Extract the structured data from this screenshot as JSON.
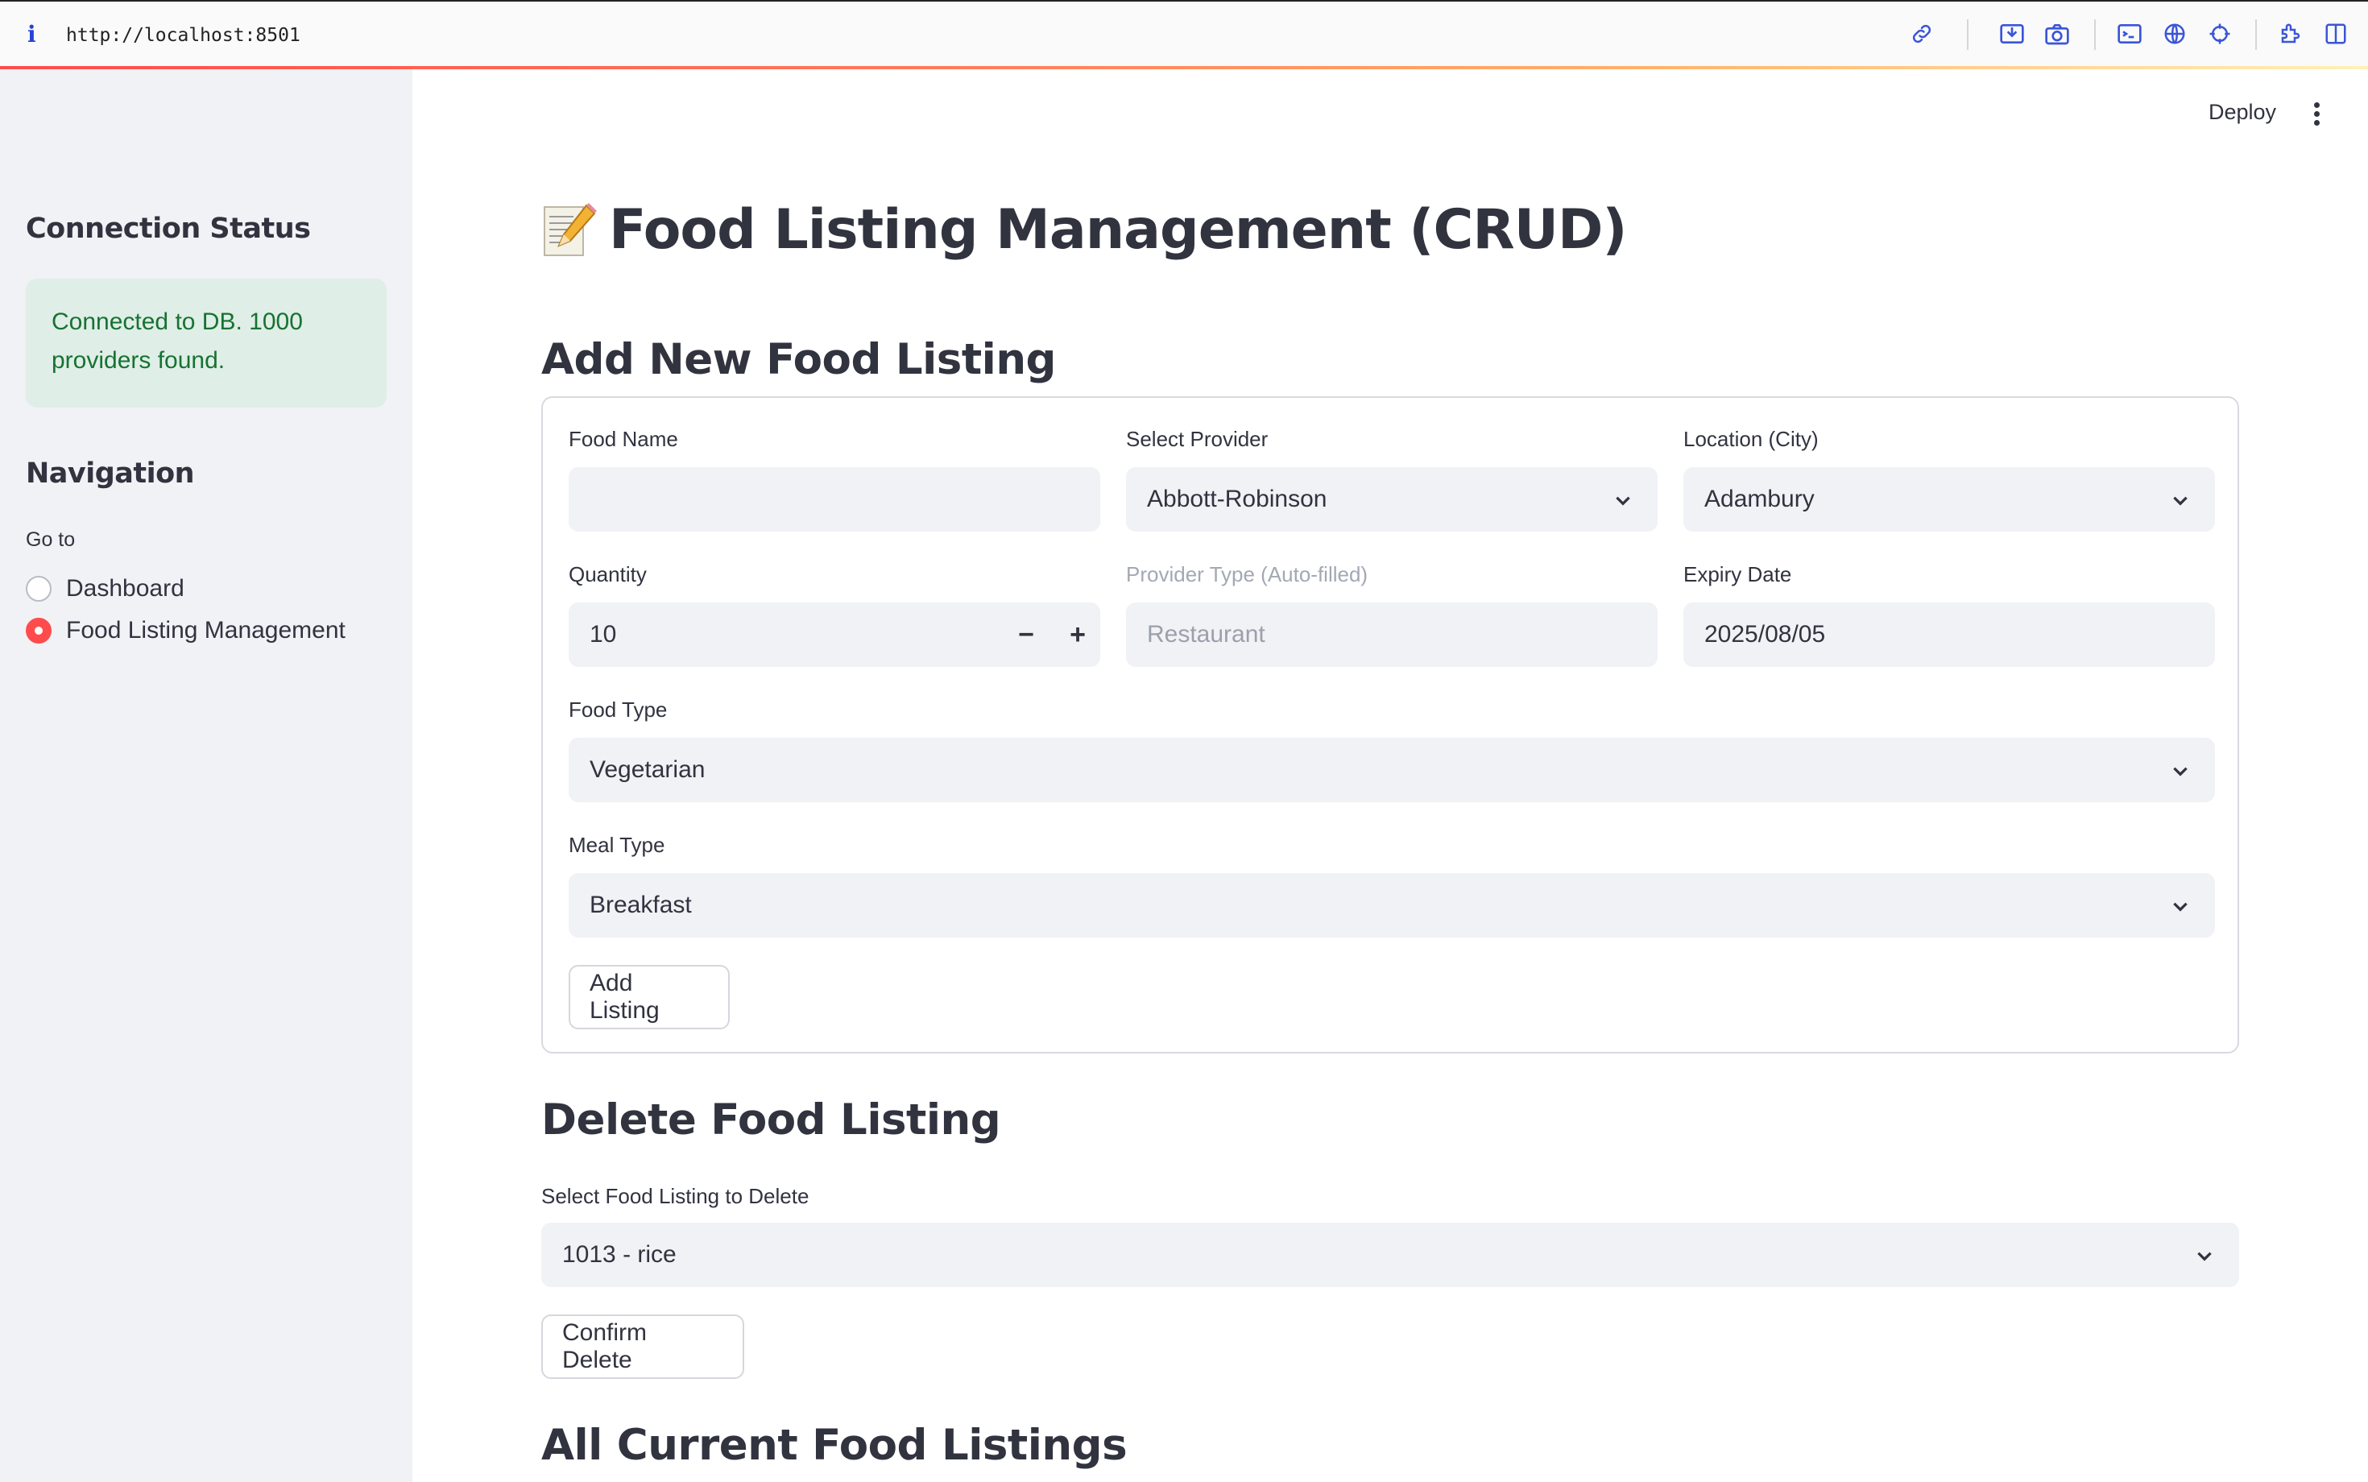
{
  "browser": {
    "url": "http://localhost:8501",
    "toolbar_icons": [
      "link-icon",
      "screenshot-area-icon",
      "camera-icon",
      "terminal-icon",
      "globe-icon",
      "crosshair-icon",
      "extensions-icon",
      "sidebar-toggle-icon"
    ]
  },
  "sidebar": {
    "connection_heading": "Connection Status",
    "status_message": "Connected to DB. 1000 providers found.",
    "navigation_heading": "Navigation",
    "goto_label": "Go to",
    "nav_options": [
      {
        "label": "Dashboard",
        "selected": false
      },
      {
        "label": "Food Listing Management",
        "selected": true
      }
    ]
  },
  "header": {
    "deploy_label": "Deploy"
  },
  "main": {
    "title": "Food Listing Management (CRUD)",
    "add_section": {
      "heading": "Add New Food Listing",
      "food_name": {
        "label": "Food Name",
        "value": ""
      },
      "provider": {
        "label": "Select Provider",
        "value": "Abbott-Robinson"
      },
      "location": {
        "label": "Location (City)",
        "value": "Adambury"
      },
      "quantity": {
        "label": "Quantity",
        "value": "10",
        "minus": "−",
        "plus": "+"
      },
      "provider_type": {
        "label": "Provider Type (Auto-filled)",
        "value": "Restaurant"
      },
      "expiry": {
        "label": "Expiry Date",
        "value": "2025/08/05"
      },
      "food_type": {
        "label": "Food Type",
        "value": "Vegetarian"
      },
      "meal_type": {
        "label": "Meal Type",
        "value": "Breakfast"
      },
      "submit_label": "Add Listing"
    },
    "delete_section": {
      "heading": "Delete Food Listing",
      "select_label": "Select Food Listing to Delete",
      "selected_value": "1013 - rice",
      "confirm_label": "Confirm Delete"
    },
    "all_section": {
      "heading": "All Current Food Listings"
    }
  },
  "colors": {
    "primary": "#ff4b4b",
    "sidebar_bg": "#f0f2f6",
    "success_bg": "#dfeee6",
    "success_text": "#177233",
    "text": "#31333f"
  }
}
